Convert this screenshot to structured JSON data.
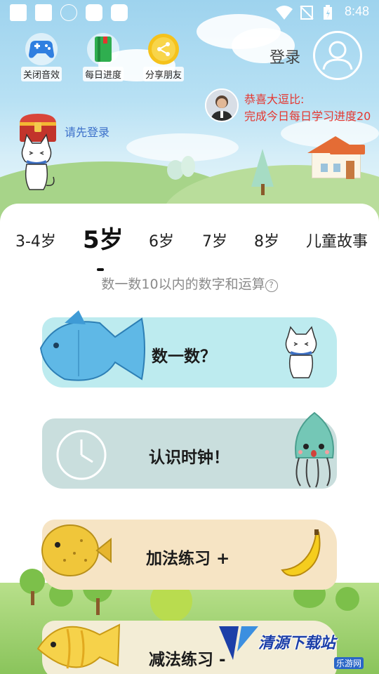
{
  "statusbar": {
    "time": "8:48"
  },
  "top_buttons": [
    {
      "label": "关闭音效",
      "icon": "gamepad-icon"
    },
    {
      "label": "每日进度",
      "icon": "book-icon"
    },
    {
      "label": "分享朋友",
      "icon": "share-coin-icon"
    }
  ],
  "login": {
    "label": "登录"
  },
  "congrats": {
    "title": "恭喜大逗比:",
    "body": "完成今日每日学习进度20"
  },
  "please_login": "请先登录",
  "tabs": [
    {
      "label": "3-4岁",
      "active": false
    },
    {
      "label": "5岁",
      "active": true
    },
    {
      "label": "6岁",
      "active": false
    },
    {
      "label": "7岁",
      "active": false
    },
    {
      "label": "8岁",
      "active": false
    },
    {
      "label": "儿童故事",
      "active": false
    }
  ],
  "subtitle": "数一数10以内的数字和运算",
  "lessons": [
    {
      "label": "数一数？",
      "color": "#bdebef"
    },
    {
      "label": "认识时钟！",
      "color": "#c9dedd"
    },
    {
      "label": "加法练习 +",
      "color": "#f6e4c4"
    },
    {
      "label": "减法练习 -",
      "color": "#f3edd6"
    }
  ],
  "watermark": {
    "text": "清源下载站",
    "sub": "乐游网"
  },
  "colors": {
    "accent_red": "#e5362f",
    "link_blue": "#3b6fc9"
  }
}
